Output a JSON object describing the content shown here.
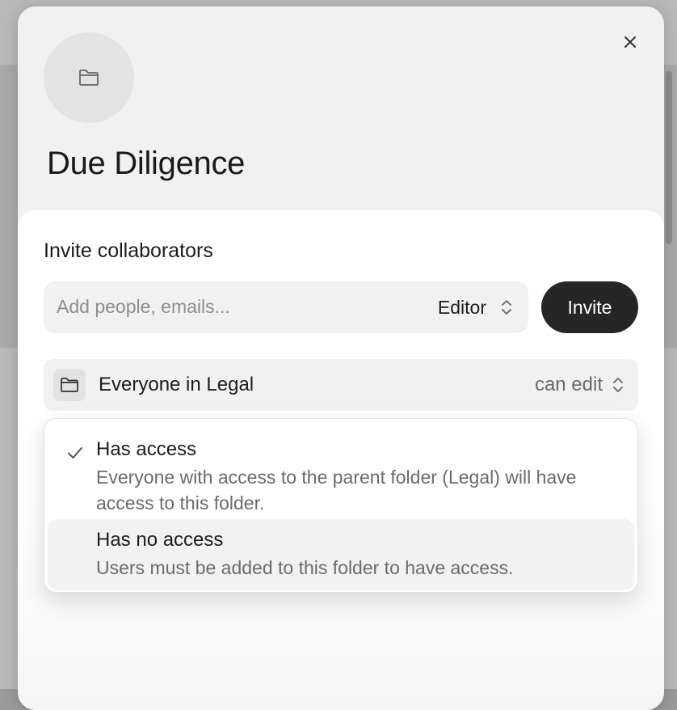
{
  "dialog": {
    "title": "Due Diligence",
    "close_icon": "close-icon",
    "folder_icon": "folder-icon"
  },
  "invite": {
    "heading": "Invite collaborators",
    "placeholder": "Add people, emails...",
    "role_value": "Editor",
    "button_label": "Invite"
  },
  "group_access": {
    "icon": "folder-icon",
    "name": "Everyone in Legal",
    "permission": "can edit"
  },
  "access_menu": {
    "options": [
      {
        "title": "Has access",
        "description": "Everyone with access to the parent folder (Legal) will have access to this folder.",
        "selected": true
      },
      {
        "title": "Has no access",
        "description": "Users must be added to this folder to have access.",
        "selected": false
      }
    ]
  },
  "colors": {
    "primary_button": "#262626",
    "field_background": "#f1f1f1",
    "muted_text": "#6b6b6b"
  }
}
